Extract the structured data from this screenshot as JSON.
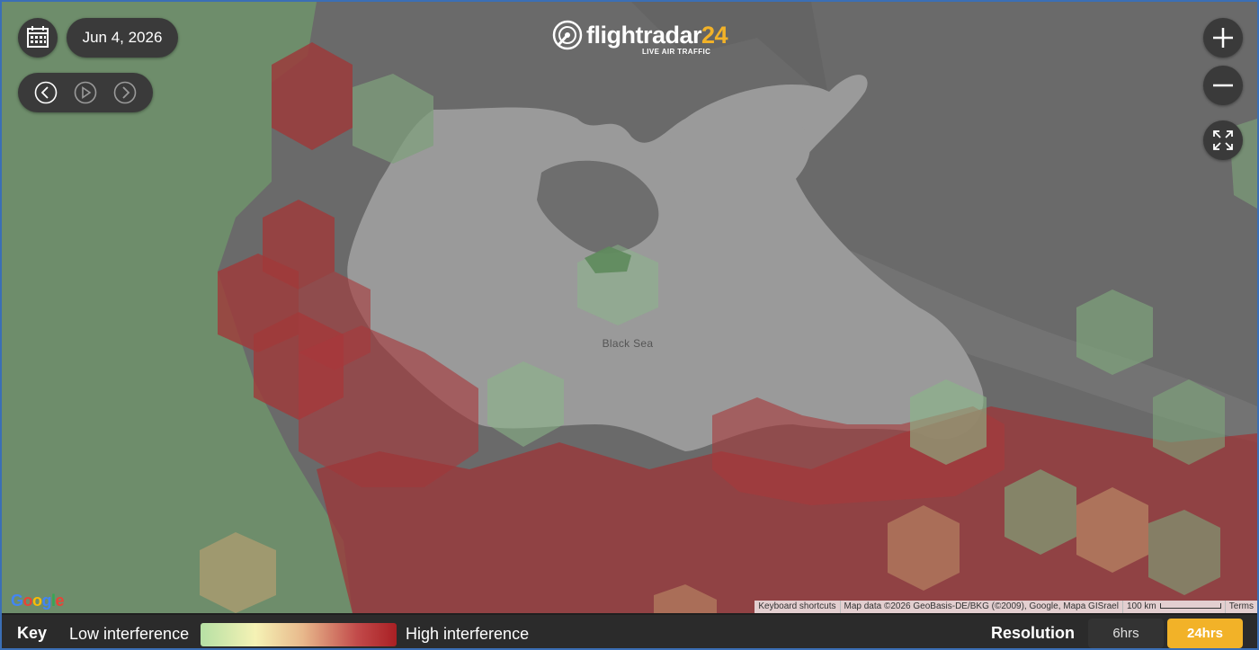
{
  "header": {
    "date": "Jun 4, 2026",
    "logo": {
      "brand_main": "flightradar",
      "brand_num": "24",
      "tagline": "LIVE AIR TRAFFIC"
    }
  },
  "map": {
    "sea_label": "Black Sea",
    "google_logo": "Google",
    "attribution": {
      "keyboard": "Keyboard shortcuts",
      "map_data": "Map data ©2026 GeoBasis-DE/BKG (©2009), Google, Mapa GISrael",
      "scale": "100 km",
      "terms": "Terms"
    },
    "interference_colors": {
      "low": "#8ab889",
      "high": "#a8393b",
      "mid": "#c9a472"
    }
  },
  "controls": {
    "calendar_icon": "calendar-icon",
    "prev_icon": "chevron-left-circle-icon",
    "play_icon": "play-circle-icon",
    "next_icon": "chevron-right-circle-icon",
    "zoom_in_icon": "plus-icon",
    "zoom_out_icon": "minus-icon",
    "fullscreen_icon": "expand-icon"
  },
  "key": {
    "title": "Key",
    "low": "Low interference",
    "high": "High interference"
  },
  "resolution": {
    "title": "Resolution",
    "options": [
      "6hrs",
      "24hrs"
    ],
    "selected": "24hrs",
    "accent": "#f2b228"
  }
}
